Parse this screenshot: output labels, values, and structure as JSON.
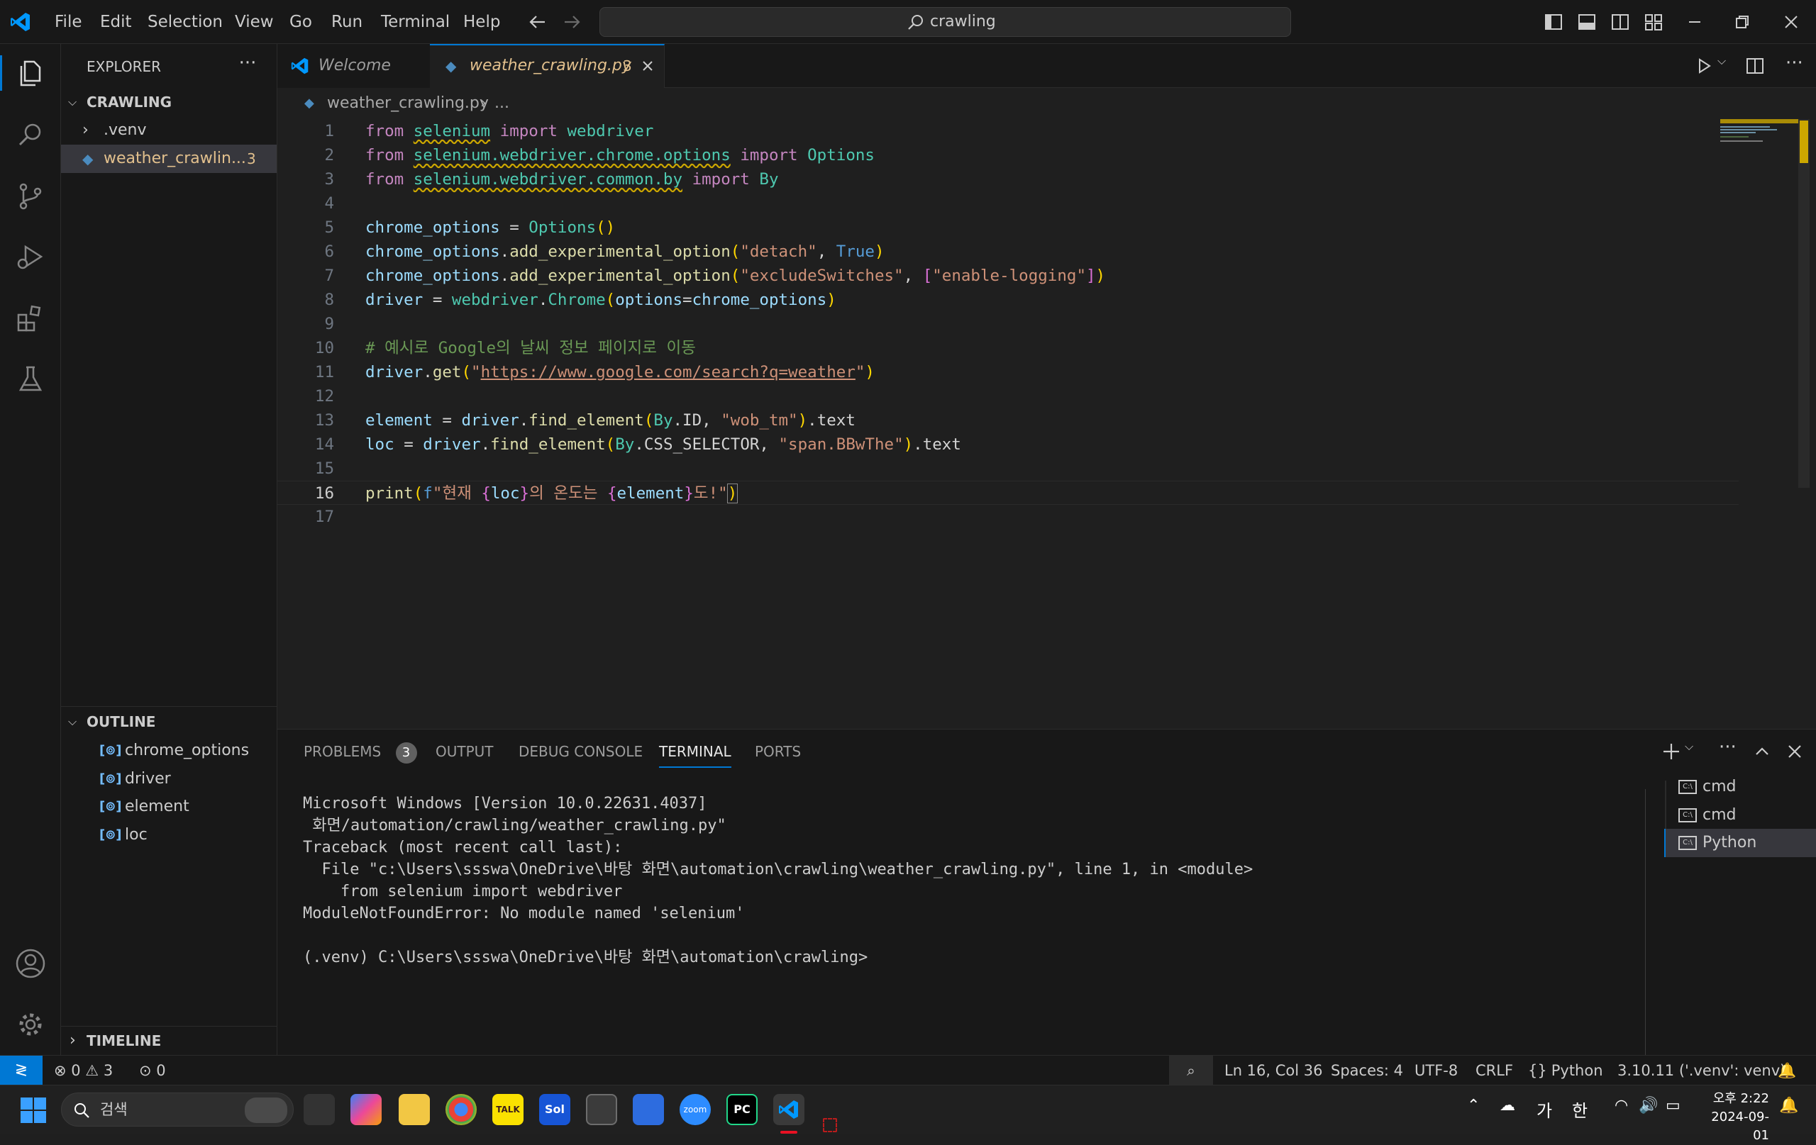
{
  "titlebar": {
    "menu": [
      "File",
      "Edit",
      "Selection",
      "View",
      "Go",
      "Run",
      "Terminal",
      "Help"
    ],
    "search_text": "crawling"
  },
  "sidebar": {
    "explorer_title": "EXPLORER",
    "folder_name": "CRAWLING",
    "items": [
      {
        "label": ".venv",
        "badge": ""
      },
      {
        "label": "weather_crawlin...",
        "badge": "3"
      }
    ],
    "outline_title": "OUTLINE",
    "outline_items": [
      "chrome_options",
      "driver",
      "element",
      "loc"
    ],
    "timeline_title": "TIMELINE"
  },
  "editor": {
    "tabs": [
      {
        "label": "Welcome"
      },
      {
        "label": "weather_crawling.py",
        "badge": "3"
      }
    ],
    "breadcrumb": {
      "file": "weather_crawling.py",
      "rest": "..."
    },
    "line_numbers": [
      "1",
      "2",
      "3",
      "4",
      "5",
      "6",
      "7",
      "8",
      "9",
      "10",
      "11",
      "12",
      "13",
      "14",
      "15",
      "16",
      "17"
    ]
  },
  "panel": {
    "tabs": [
      "PROBLEMS",
      "OUTPUT",
      "DEBUG CONSOLE",
      "TERMINAL",
      "PORTS"
    ],
    "problems_count": "3",
    "active_tab": "TERMINAL",
    "terminal_lines": [
      "Microsoft Windows [Version 10.0.22631.4037]",
      " 화면/automation/crawling/weather_crawling.py\"",
      "Traceback (most recent call last):",
      "  File \"c:\\Users\\ssswa\\OneDrive\\바탕 화면\\automation\\crawling\\weather_crawling.py\", line 1, in <module>",
      "    from selenium import webdriver",
      "ModuleNotFoundError: No module named 'selenium'",
      "",
      "(.venv) C:\\Users\\ssswa\\OneDrive\\바탕 화면\\automation\\crawling>"
    ],
    "terminal_list": [
      "cmd",
      "cmd",
      "Python"
    ]
  },
  "statusbar": {
    "errors": "0",
    "warnings": "3",
    "ports": "0",
    "position": "Ln 16, Col 36",
    "spaces": "Spaces: 4",
    "encoding": "UTF-8",
    "eol": "CRLF",
    "language": "Python",
    "interpreter": "3.10.11 ('.venv': venv)"
  },
  "taskbar": {
    "search_placeholder": "검색",
    "ime1": "가",
    "ime2": "한",
    "time": "오후 2:22",
    "date": "2024-09-01"
  },
  "colors": {
    "accent": "#0078d4",
    "modified_file": "#e2c08d",
    "warning": "#cca700"
  }
}
